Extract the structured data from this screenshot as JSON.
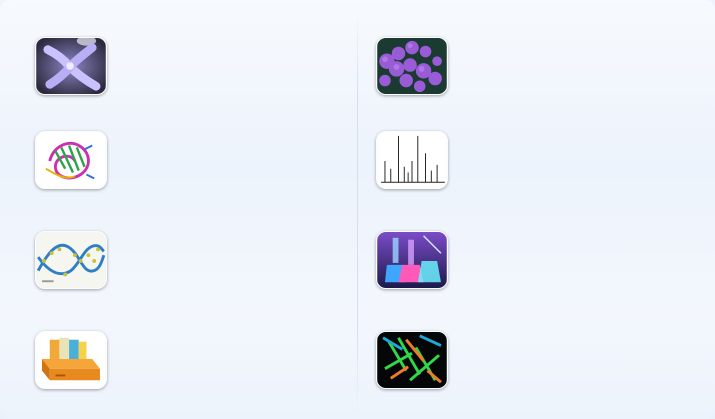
{
  "tiles": {
    "left": [
      {
        "icon": "chromosome-icon"
      },
      {
        "icon": "protein-structure-icon"
      },
      {
        "icon": "dna-helix-icon"
      },
      {
        "icon": "file-box-icon"
      }
    ],
    "right": [
      {
        "icon": "bacteria-icon"
      },
      {
        "icon": "spectrum-chart-icon"
      },
      {
        "icon": "lab-flask-icon"
      },
      {
        "icon": "crystal-structure-icon"
      }
    ]
  },
  "colors": {
    "background": "#edf3fc",
    "divider": "#d5e0ef"
  }
}
